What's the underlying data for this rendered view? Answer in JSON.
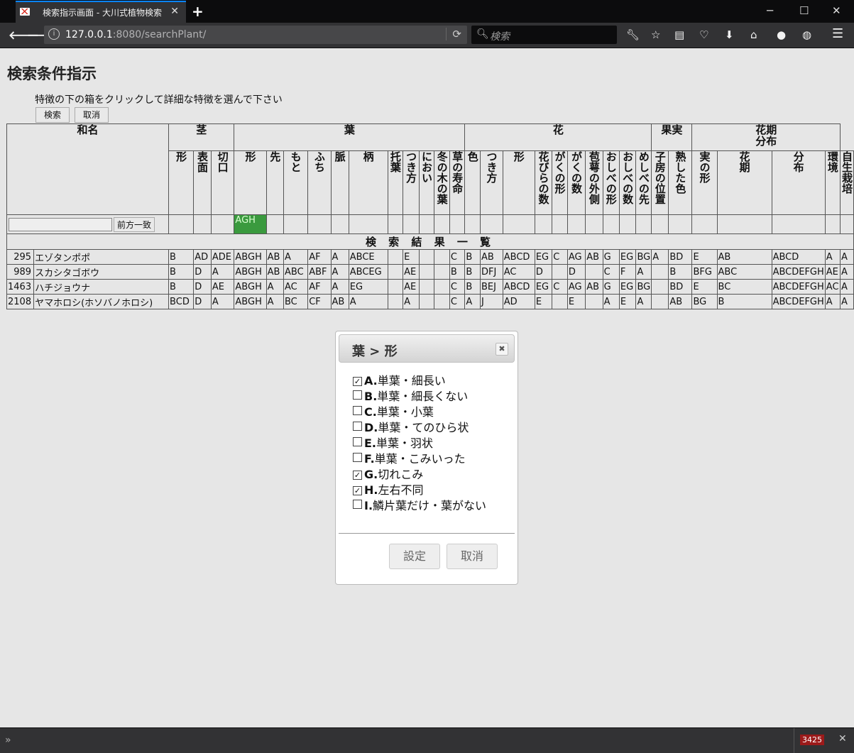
{
  "browser": {
    "tab_title": "検索指示画面 - 大川式植物検索",
    "url_host": "127.0.0.1",
    "url_rest": ":8080/searchPlant/",
    "search_placeholder": "検索",
    "status_badge": "3425",
    "accent_color": "#0a84ff"
  },
  "page": {
    "title": "検索条件指示",
    "instruction": "特徴の下の箱をクリックして詳細な特徴を選んで下さい",
    "search_button": "検索",
    "cancel_button": "取消"
  },
  "table": {
    "group_headers": [
      "和名",
      "茎",
      "葉",
      "花",
      "果実",
      "花期\n分布"
    ],
    "sub_headers": [
      "形",
      "表面",
      "切口",
      "形",
      "先",
      "もと",
      "ふち",
      "脈",
      "柄",
      "托葉",
      "つき方",
      "におい",
      "冬の木の葉",
      "草の寿命",
      "色",
      "つき方",
      "形",
      "花びらの数",
      "がくの形",
      "がくの数",
      "苞萼の外側",
      "おしべの形",
      "おしべの数",
      "めしべの先",
      "子房の位置",
      "熟した色",
      "実の形",
      "花期",
      "分布",
      "環境",
      "自生栽培"
    ],
    "name_match_button": "前方一致",
    "selected_leaf_shape": "AGH",
    "selected_color": "#3a9a3e",
    "results_title": "検 索 結 果 一 覧",
    "rows": [
      {
        "id": "295",
        "name": "エゾタンポポ",
        "cells": [
          "B",
          "AD",
          "ADE",
          "ABGH",
          "AB",
          "A",
          "AF",
          "A",
          "ABCE",
          "",
          "E",
          "",
          "",
          "C",
          "B",
          "AB",
          "ABCD",
          "EG",
          "C",
          "AG",
          "AB",
          "G",
          "EG",
          "BG",
          "A",
          "BD",
          "E",
          "AB",
          "ABCD",
          "A",
          "A"
        ]
      },
      {
        "id": "989",
        "name": "スカシタゴボウ",
        "cells": [
          "B",
          "D",
          "A",
          "ABGH",
          "AB",
          "ABC",
          "ABF",
          "A",
          "ABCEG",
          "",
          "AE",
          "",
          "",
          "B",
          "B",
          "DFJ",
          "AC",
          "D",
          "",
          "D",
          "",
          "C",
          "F",
          "A",
          "",
          "B",
          "BFG",
          "ABC",
          "ABCDEFGH",
          "AE",
          "A"
        ]
      },
      {
        "id": "1463",
        "name": "ハチジョウナ",
        "cells": [
          "B",
          "D",
          "AE",
          "ABGH",
          "A",
          "AC",
          "AF",
          "A",
          "EG",
          "",
          "AE",
          "",
          "",
          "C",
          "B",
          "BEJ",
          "ABCD",
          "EG",
          "C",
          "AG",
          "AB",
          "G",
          "EG",
          "BG",
          "",
          "BD",
          "E",
          "BC",
          "ABCDEFGH",
          "AC",
          "A"
        ]
      },
      {
        "id": "2108",
        "name": "ヤマホロシ(ホソバノホロシ)",
        "cells": [
          "BCD",
          "D",
          "A",
          "ABGH",
          "A",
          "BC",
          "CF",
          "AB",
          "A",
          "",
          "A",
          "",
          "",
          "C",
          "A",
          "J",
          "AD",
          "E",
          "",
          "E",
          "",
          "A",
          "E",
          "A",
          "",
          "AB",
          "BG",
          "B",
          "ABCDEFGH",
          "A",
          "A"
        ]
      }
    ]
  },
  "dialog": {
    "title": "葉 > 形",
    "options": [
      {
        "key": "A.",
        "label": "単葉・細長い",
        "checked": true
      },
      {
        "key": "B.",
        "label": "単葉・細長くない",
        "checked": false
      },
      {
        "key": "C.",
        "label": "単葉・小葉",
        "checked": false
      },
      {
        "key": "D.",
        "label": "単葉・てのひら状",
        "checked": false
      },
      {
        "key": "E.",
        "label": "単葉・羽状",
        "checked": false
      },
      {
        "key": "F.",
        "label": "単葉・こみいった",
        "checked": false
      },
      {
        "key": "G.",
        "label": "切れこみ",
        "checked": true
      },
      {
        "key": "H.",
        "label": "左右不同",
        "checked": true
      },
      {
        "key": "I.",
        "label": "鱗片葉だけ・葉がない",
        "checked": false
      }
    ],
    "ok_button": "設定",
    "cancel_button": "取消"
  }
}
